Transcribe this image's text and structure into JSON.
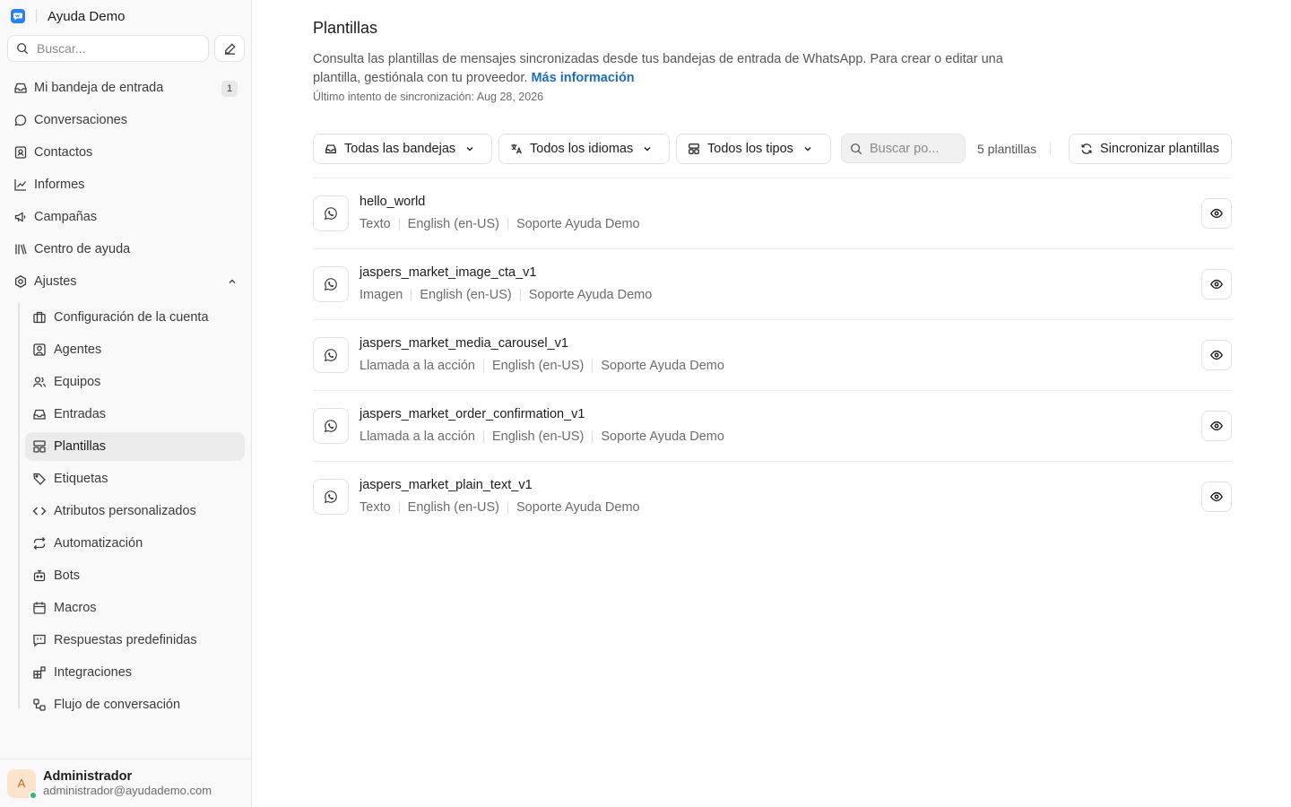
{
  "app": {
    "workspace_name": "Ayuda Demo"
  },
  "sidebar": {
    "search_placeholder": "Buscar...",
    "nav": [
      {
        "label": "Mi bandeja de entrada",
        "icon": "inbox-icon",
        "badge": "1"
      },
      {
        "label": "Conversaciones",
        "icon": "chat-bubble-icon"
      },
      {
        "label": "Contactos",
        "icon": "contact-card-icon"
      },
      {
        "label": "Informes",
        "icon": "line-chart-icon"
      },
      {
        "label": "Campañas",
        "icon": "megaphone-icon"
      },
      {
        "label": "Centro de ayuda",
        "icon": "library-icon"
      },
      {
        "label": "Ajustes",
        "icon": "settings-icon",
        "expanded": true
      }
    ],
    "settings_items": [
      {
        "label": "Configuración de la cuenta",
        "icon": "briefcase-icon"
      },
      {
        "label": "Agentes",
        "icon": "user-square-icon"
      },
      {
        "label": "Equipos",
        "icon": "users-icon"
      },
      {
        "label": "Entradas",
        "icon": "inbox-icon"
      },
      {
        "label": "Plantillas",
        "icon": "layout-template-icon",
        "active": true
      },
      {
        "label": "Etiquetas",
        "icon": "tag-icon"
      },
      {
        "label": "Atributos personalizados",
        "icon": "code-icon"
      },
      {
        "label": "Automatización",
        "icon": "repeat-icon"
      },
      {
        "label": "Bots",
        "icon": "bot-icon"
      },
      {
        "label": "Macros",
        "icon": "calendar-icon"
      },
      {
        "label": "Respuestas predefinidas",
        "icon": "quote-message-icon"
      },
      {
        "label": "Integraciones",
        "icon": "blocks-icon"
      },
      {
        "label": "Flujo de conversación",
        "icon": "workflow-icon"
      }
    ],
    "user": {
      "initial": "A",
      "name": "Administrador",
      "email": "administrador@ayudademo.com",
      "status_color": "#2eb67d"
    }
  },
  "main": {
    "title": "Plantillas",
    "description": "Consulta las plantillas de mensajes sincronizadas desde tus bandejas de entrada de WhatsApp. Para crear o editar una plantilla, gestiónala con tu proveedor.",
    "learn_more": "Más información",
    "last_sync": "Último intento de sincronización: Aug 28, 2026",
    "filters": {
      "inbox": "Todas las bandejas",
      "language": "Todos los idiomas",
      "type": "Todos los tipos",
      "search_placeholder": "Buscar po...",
      "count": "5 plantillas",
      "sync_button": "Sincronizar plantillas"
    },
    "templates": [
      {
        "name": "hello_world",
        "type": "Texto",
        "language": "English (en-US)",
        "inbox": "Soporte Ayuda Demo"
      },
      {
        "name": "jaspers_market_image_cta_v1",
        "type": "Imagen",
        "language": "English (en-US)",
        "inbox": "Soporte Ayuda Demo"
      },
      {
        "name": "jaspers_market_media_carousel_v1",
        "type": "Llamada a la acción",
        "language": "English (en-US)",
        "inbox": "Soporte Ayuda Demo"
      },
      {
        "name": "jaspers_market_order_confirmation_v1",
        "type": "Llamada a la acción",
        "language": "English (en-US)",
        "inbox": "Soporte Ayuda Demo"
      },
      {
        "name": "jaspers_market_plain_text_v1",
        "type": "Texto",
        "language": "English (en-US)",
        "inbox": "Soporte Ayuda Demo"
      }
    ]
  },
  "colors": {
    "accent": "#2781f6",
    "link": "#1b6ec2",
    "active_bg": "#ebebeb"
  }
}
